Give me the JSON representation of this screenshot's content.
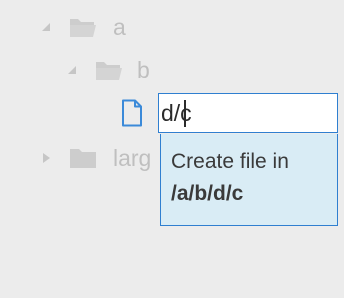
{
  "tree": {
    "items": [
      {
        "label": "a",
        "expanded": true,
        "icon": "folder-open-icon"
      },
      {
        "label": "b",
        "expanded": true,
        "icon": "folder-open-icon"
      },
      {
        "label": "larg",
        "expanded": false,
        "icon": "folder-icon"
      }
    ],
    "new_file": {
      "icon": "file-icon",
      "input_value": "d/c"
    }
  },
  "hint": {
    "prefix": "Create file in",
    "path": "/a/b/d/c"
  },
  "colors": {
    "accent": "#2f7fd0",
    "hint_background": "#d9ecf5",
    "background": "#ececec"
  }
}
